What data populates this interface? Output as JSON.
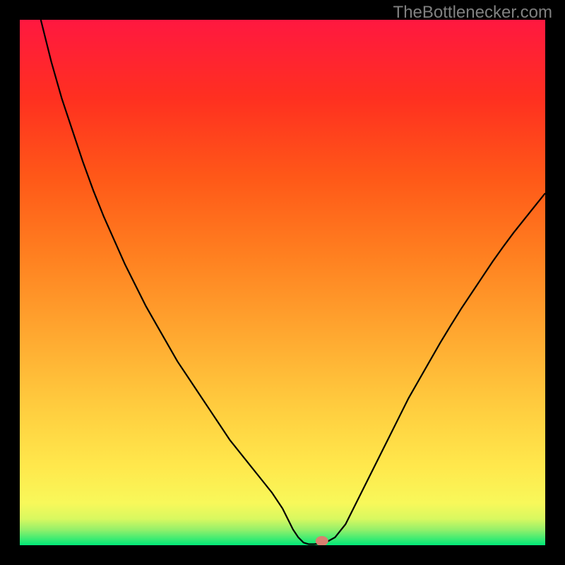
{
  "watermark": "TheBottlenecker.com",
  "chart_data": {
    "type": "line",
    "title": "",
    "xlabel": "",
    "ylabel": "",
    "xlim": [
      0,
      100
    ],
    "ylim": [
      0,
      100
    ],
    "background_gradient": {
      "stops": [
        {
          "offset": 0,
          "color": "#00e878"
        },
        {
          "offset": 3,
          "color": "#96f06a"
        },
        {
          "offset": 5,
          "color": "#d8f860"
        },
        {
          "offset": 8,
          "color": "#f8f85a"
        },
        {
          "offset": 15,
          "color": "#ffe84c"
        },
        {
          "offset": 25,
          "color": "#ffd040"
        },
        {
          "offset": 40,
          "color": "#ffa830"
        },
        {
          "offset": 55,
          "color": "#ff8020"
        },
        {
          "offset": 70,
          "color": "#ff5818"
        },
        {
          "offset": 85,
          "color": "#ff3020"
        },
        {
          "offset": 100,
          "color": "#ff1840"
        }
      ]
    },
    "series": [
      {
        "name": "bottleneck-curve",
        "x": [
          4,
          6,
          8,
          10,
          12,
          14,
          16,
          18,
          20,
          22,
          24,
          26,
          28,
          30,
          32,
          34,
          36,
          38,
          40,
          42,
          44,
          46,
          48,
          50,
          51,
          52,
          53,
          54,
          55,
          56,
          58,
          60,
          62,
          64,
          66,
          68,
          70,
          72,
          74,
          76,
          78,
          80,
          82,
          84,
          86,
          88,
          90,
          92,
          94,
          96,
          98,
          100
        ],
        "y": [
          100,
          92,
          85,
          79,
          73,
          67.5,
          62.5,
          58,
          53.5,
          49.5,
          45.5,
          42,
          38.5,
          35,
          32,
          29,
          26,
          23,
          20,
          17.5,
          15,
          12.5,
          10,
          7,
          5,
          3,
          1.5,
          0.5,
          0.2,
          0.2,
          0.4,
          1.5,
          4,
          8,
          12,
          16,
          20,
          24,
          28,
          31.5,
          35,
          38.5,
          41.8,
          45,
          48,
          51,
          54,
          56.8,
          59.5,
          62,
          64.5,
          67
        ]
      }
    ],
    "marker": {
      "x": 57.5,
      "y": 0.8,
      "color": "#d88070"
    }
  }
}
